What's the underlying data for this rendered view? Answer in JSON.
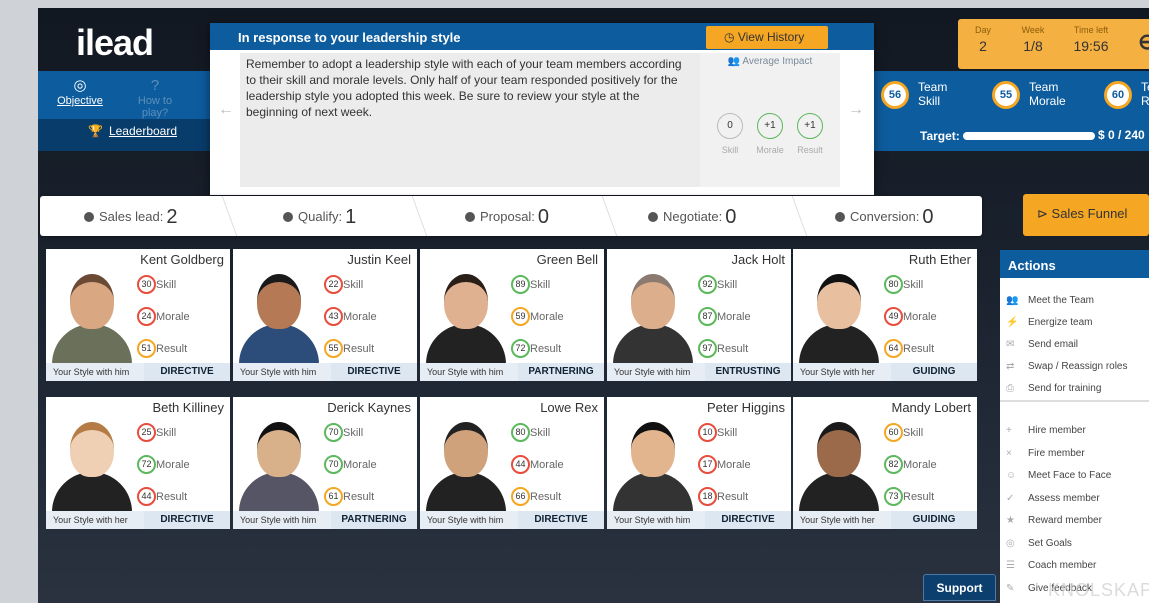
{
  "app": {
    "logo": "ilead"
  },
  "nav": {
    "objective": "Objective",
    "howto": "How to play?",
    "leaderboard": "Leaderboard"
  },
  "popup": {
    "title": "In response to your leadership style",
    "view_history": "View History",
    "message": "Remember to adopt a leadership style with each of your team members according to their skill and morale levels. Only half of your team responded positively for the leadership style you adopted this week. Be sure to review your style at the beginning of next week.",
    "impact_label": "Average Impact",
    "impact": [
      {
        "value": "0",
        "label": "Skill"
      },
      {
        "value": "+1",
        "label": "Morale"
      },
      {
        "value": "+1",
        "label": "Result"
      }
    ]
  },
  "stats": {
    "day_label": "Day",
    "day": "2",
    "week_label": "Week",
    "week": "1/8",
    "time_label": "Time left",
    "time": "19:56"
  },
  "metrics": [
    {
      "value": "56",
      "l1": "Team",
      "l2": "Skill"
    },
    {
      "value": "55",
      "l1": "Team",
      "l2": "Morale"
    },
    {
      "value": "60",
      "l1": "Te",
      "l2": "R"
    }
  ],
  "target": {
    "label": "Target:",
    "value": "$ 0 / 240"
  },
  "funnel": [
    {
      "label": "Sales lead:",
      "value": "2"
    },
    {
      "label": "Qualify:",
      "value": "1"
    },
    {
      "label": "Proposal:",
      "value": "0"
    },
    {
      "label": "Negotiate:",
      "value": "0"
    },
    {
      "label": "Conversion:",
      "value": "0"
    }
  ],
  "sales_funnel": "Sales Funnel",
  "labels": {
    "skill": "Skill",
    "morale": "Morale",
    "result": "Result"
  },
  "members": [
    {
      "name": "Kent Goldberg",
      "skill": "30",
      "morale": "24",
      "result": "51",
      "ystyle": "Your Style with him",
      "style": "DIRECTIVE"
    },
    {
      "name": "Justin Keel",
      "skill": "22",
      "morale": "43",
      "result": "55",
      "ystyle": "Your Style with him",
      "style": "DIRECTIVE"
    },
    {
      "name": "Green Bell",
      "skill": "89",
      "morale": "59",
      "result": "72",
      "ystyle": "Your Style with him",
      "style": "PARTNERING"
    },
    {
      "name": "Jack Holt",
      "skill": "92",
      "morale": "87",
      "result": "97",
      "ystyle": "Your Style with him",
      "style": "ENTRUSTING"
    },
    {
      "name": "Ruth Ether",
      "skill": "80",
      "morale": "49",
      "result": "64",
      "ystyle": "Your Style with her",
      "style": "GUIDING"
    },
    {
      "name": "Beth Killiney",
      "skill": "25",
      "morale": "72",
      "result": "44",
      "ystyle": "Your Style with her",
      "style": "DIRECTIVE"
    },
    {
      "name": "Derick Kaynes",
      "skill": "70",
      "morale": "70",
      "result": "61",
      "ystyle": "Your Style with him",
      "style": "PARTNERING"
    },
    {
      "name": "Lowe Rex",
      "skill": "80",
      "morale": "44",
      "result": "66",
      "ystyle": "Your Style with him",
      "style": "DIRECTIVE"
    },
    {
      "name": "Peter Higgins",
      "skill": "10",
      "morale": "17",
      "result": "18",
      "ystyle": "Your Style with him",
      "style": "DIRECTIVE"
    },
    {
      "name": "Mandy Lobert",
      "skill": "60",
      "morale": "82",
      "result": "73",
      "ystyle": "Your Style with her",
      "style": "GUIDING"
    }
  ],
  "actions": {
    "title": "Actions",
    "group1": [
      "Meet the Team",
      "Energize team",
      "Send email",
      "Swap / Reassign roles",
      "Send for training"
    ],
    "group2": [
      "Hire member",
      "Fire member",
      "Meet Face to Face",
      "Assess member",
      "Reward member",
      "Set Goals",
      "Coach member",
      "Give feedback"
    ]
  },
  "support": "Support",
  "watermark": "KNOLSKAPE"
}
